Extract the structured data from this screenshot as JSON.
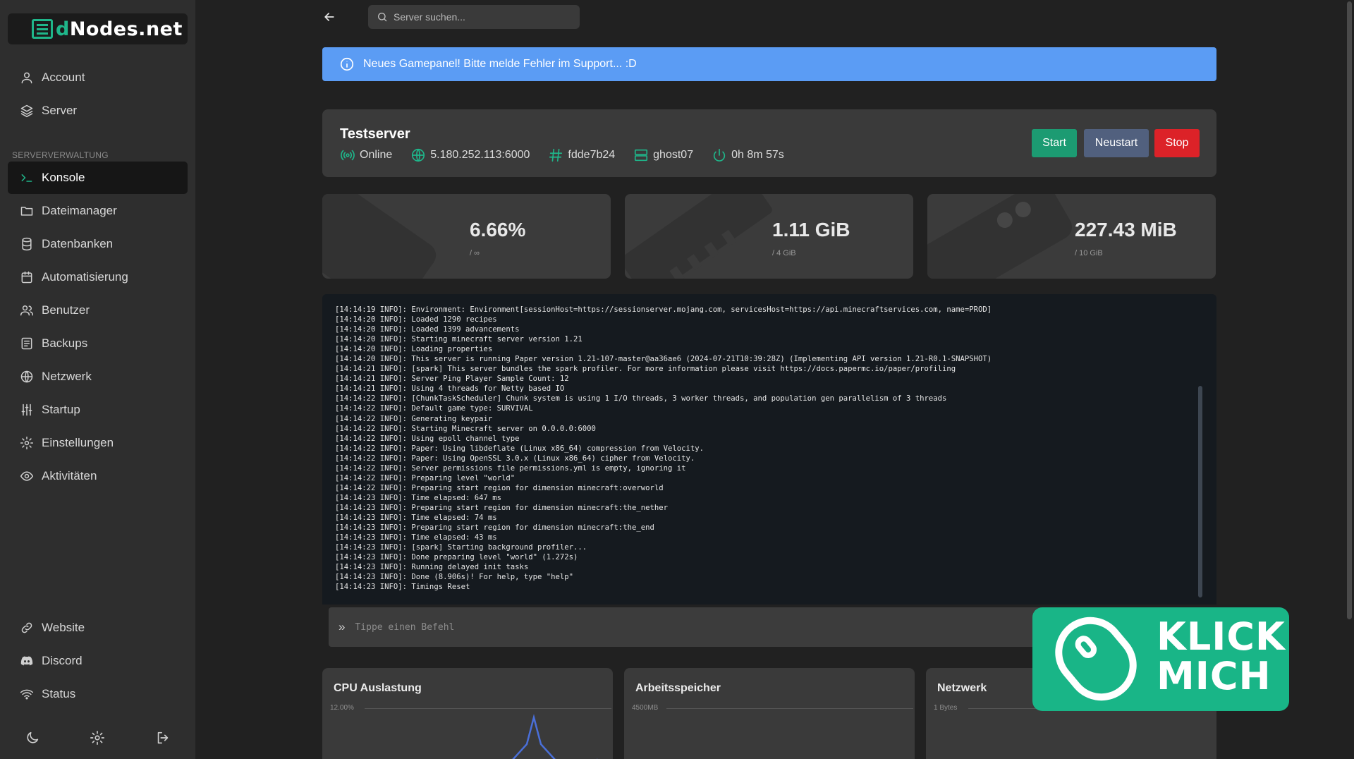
{
  "brand": {
    "logo_prefix": "d",
    "logo_main": "Nodes.net"
  },
  "sidebar": {
    "items_top": [
      {
        "label": "Account",
        "icon": "user-icon"
      },
      {
        "label": "Server",
        "icon": "layers-icon"
      }
    ],
    "section_label": "SERVERVERWALTUNG",
    "items_manage": [
      {
        "label": "Konsole",
        "icon": "terminal-icon",
        "active": true
      },
      {
        "label": "Dateimanager",
        "icon": "folder-icon"
      },
      {
        "label": "Datenbanken",
        "icon": "database-icon"
      },
      {
        "label": "Automatisierung",
        "icon": "calendar-icon"
      },
      {
        "label": "Benutzer",
        "icon": "users-icon"
      },
      {
        "label": "Backups",
        "icon": "archive-icon"
      },
      {
        "label": "Netzwerk",
        "icon": "globe-icon"
      },
      {
        "label": "Startup",
        "icon": "sliders-icon"
      },
      {
        "label": "Einstellungen",
        "icon": "gear-icon"
      },
      {
        "label": "Aktivitäten",
        "icon": "eye-icon"
      }
    ],
    "items_bottom": [
      {
        "label": "Website",
        "icon": "link-icon"
      },
      {
        "label": "Discord",
        "icon": "discord-icon"
      },
      {
        "label": "Status",
        "icon": "wifi-icon"
      }
    ]
  },
  "search": {
    "placeholder": "Server suchen..."
  },
  "banner": {
    "text": "Neues Gamepanel! Bitte melde Fehler im Support... :D"
  },
  "server": {
    "name": "Testserver",
    "status": "Online",
    "address": "5.180.252.113:6000",
    "id": "fdde7b24",
    "node": "ghost07",
    "uptime": "0h 8m 57s",
    "buttons": {
      "start": "Start",
      "restart": "Neustart",
      "stop": "Stop"
    }
  },
  "stats": {
    "cpu": {
      "value": "6.66%",
      "limit": "/ ∞"
    },
    "memory": {
      "value": "1.11 GiB",
      "limit": "/ 4 GiB"
    },
    "disk": {
      "value": "227.43 MiB",
      "limit": "/ 10 GiB"
    }
  },
  "console": {
    "lines": [
      "[14:14:19 INFO]: Environment: Environment[sessionHost=https://sessionserver.mojang.com, servicesHost=https://api.minecraftservices.com, name=PROD]",
      "[14:14:20 INFO]: Loaded 1290 recipes",
      "[14:14:20 INFO]: Loaded 1399 advancements",
      "[14:14:20 INFO]: Starting minecraft server version 1.21",
      "[14:14:20 INFO]: Loading properties",
      "[14:14:20 INFO]: This server is running Paper version 1.21-107-master@aa36ae6 (2024-07-21T10:39:28Z) (Implementing API version 1.21-R0.1-SNAPSHOT)",
      "[14:14:21 INFO]: [spark] This server bundles the spark profiler. For more information please visit https://docs.papermc.io/paper/profiling",
      "[14:14:21 INFO]: Server Ping Player Sample Count: 12",
      "[14:14:21 INFO]: Using 4 threads for Netty based IO",
      "[14:14:22 INFO]: [ChunkTaskScheduler] Chunk system is using 1 I/O threads, 3 worker threads, and population gen parallelism of 3 threads",
      "[14:14:22 INFO]: Default game type: SURVIVAL",
      "[14:14:22 INFO]: Generating keypair",
      "[14:14:22 INFO]: Starting Minecraft server on 0.0.0.0:6000",
      "[14:14:22 INFO]: Using epoll channel type",
      "[14:14:22 INFO]: Paper: Using libdeflate (Linux x86_64) compression from Velocity.",
      "[14:14:22 INFO]: Paper: Using OpenSSL 3.0.x (Linux x86_64) cipher from Velocity.",
      "[14:14:22 INFO]: Server permissions file permissions.yml is empty, ignoring it",
      "[14:14:22 INFO]: Preparing level \"world\"",
      "[14:14:22 INFO]: Preparing start region for dimension minecraft:overworld",
      "[14:14:23 INFO]: Time elapsed: 647 ms",
      "[14:14:23 INFO]: Preparing start region for dimension minecraft:the_nether",
      "[14:14:23 INFO]: Time elapsed: 74 ms",
      "[14:14:23 INFO]: Preparing start region for dimension minecraft:the_end",
      "[14:14:23 INFO]: Time elapsed: 43 ms",
      "[14:14:23 INFO]: [spark] Starting background profiler...",
      "[14:14:23 INFO]: Done preparing level \"world\" (1.272s)",
      "[14:14:23 INFO]: Running delayed init tasks",
      "[14:14:23 INFO]: Done (8.906s)! For help, type \"help\"",
      "[14:14:23 INFO]: Timings Reset"
    ],
    "command_placeholder": "Tippe einen Befehl"
  },
  "graphs": [
    {
      "title": "CPU Auslastung",
      "scale": "12.00%"
    },
    {
      "title": "Arbeitsspeicher",
      "scale": "4500MB"
    },
    {
      "title": "Netzwerk",
      "scale": "1 Bytes"
    }
  ],
  "promo": {
    "line1": "KLICK",
    "line2": "MICH"
  },
  "colors": {
    "accent": "#1fb68a",
    "banner": "#5b9cf4",
    "stop": "#dc2228",
    "restart": "#51607e",
    "start": "#1c9b72"
  }
}
